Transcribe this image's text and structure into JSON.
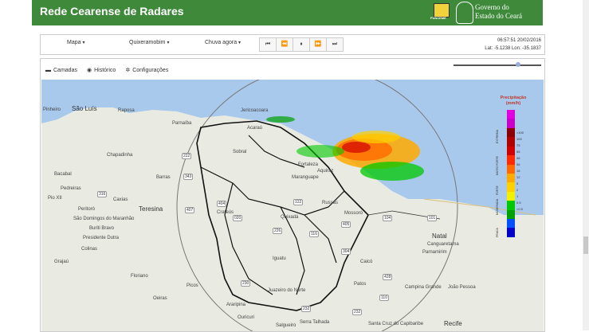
{
  "header": {
    "title": "Rede Cearense de Radares",
    "logo_funceme_text": "FUNCEME",
    "gov_line1": "Governo do",
    "gov_line2": "Estado do Ceará"
  },
  "toolbar": {
    "dropdowns": [
      {
        "label": "Mapa"
      },
      {
        "label": "Quixeramobim"
      },
      {
        "label": "Chuva agora"
      }
    ],
    "playback": [
      "⏮",
      "⏪",
      "⏸",
      "⏩",
      "⏭"
    ],
    "datetime": "06:57:51 20/02/2016",
    "latlon": "Lat: -5.1238    Lon: -35.1837"
  },
  "tabs": [
    {
      "label": "Camadas",
      "icon": "layers-icon"
    },
    {
      "label": "Histórico",
      "icon": "clock-icon"
    },
    {
      "label": "Configurações",
      "icon": "gear-icon"
    }
  ],
  "legend": {
    "title": "Precipitação",
    "unit": "(mm/h)",
    "values": [
      ">100",
      "100",
      "75",
      "55",
      "48",
      "36",
      "18",
      "12",
      "5",
      "2",
      "1",
      "0.5",
      "<0.5"
    ],
    "categories": [
      "EXTREMA",
      "MUITO FORTE",
      "FORTE",
      "MODERADA",
      "FRACA"
    ],
    "colors": [
      "#e000e0",
      "#c800c8",
      "#8a0000",
      "#b00000",
      "#d00000",
      "#ff2a00",
      "#ff6a00",
      "#ffaa00",
      "#ffd000",
      "#f0f000",
      "#00c800",
      "#00a000",
      "#0050ff",
      "#0000c8"
    ]
  },
  "map": {
    "labels_big": [
      "São Luís",
      "Teresina",
      "Natal",
      "Recife"
    ],
    "labels": [
      "Pinheiro",
      "Raposa",
      "Bacabal",
      "Pedreiras",
      "Presidente Dutra",
      "Caxias",
      "Chapadinha",
      "Parnaíba",
      "Sobral",
      "Acaraú",
      "Jericoacoara",
      "Fortaleza",
      "Aquiraz",
      "Crateús",
      "Quixadá",
      "Russas",
      "Mossoró",
      "Iguatu",
      "Juazeiro do Norte",
      "Picos",
      "Patos",
      "Campina Grande",
      "João Pessoa",
      "Caicó",
      "Canguaretama",
      "Parnamirim",
      "Araripina",
      "Ouricuri",
      "Salgueiro",
      "Serra Talhada",
      "Santa Cruz do Capibaribe",
      "Floriano",
      "Oeiras",
      "Peritoró",
      "Pio XII",
      "São Domingos do Maranhão",
      "Buriti Bravo",
      "Colinas",
      "Grajaú",
      "Barras",
      "Maranguape"
    ],
    "roads": [
      "222",
      "343",
      "316",
      "407",
      "404",
      "020",
      "226",
      "116",
      "122",
      "304",
      "405",
      "104",
      "101",
      "110",
      "230",
      "232",
      "428",
      "232"
    ]
  }
}
